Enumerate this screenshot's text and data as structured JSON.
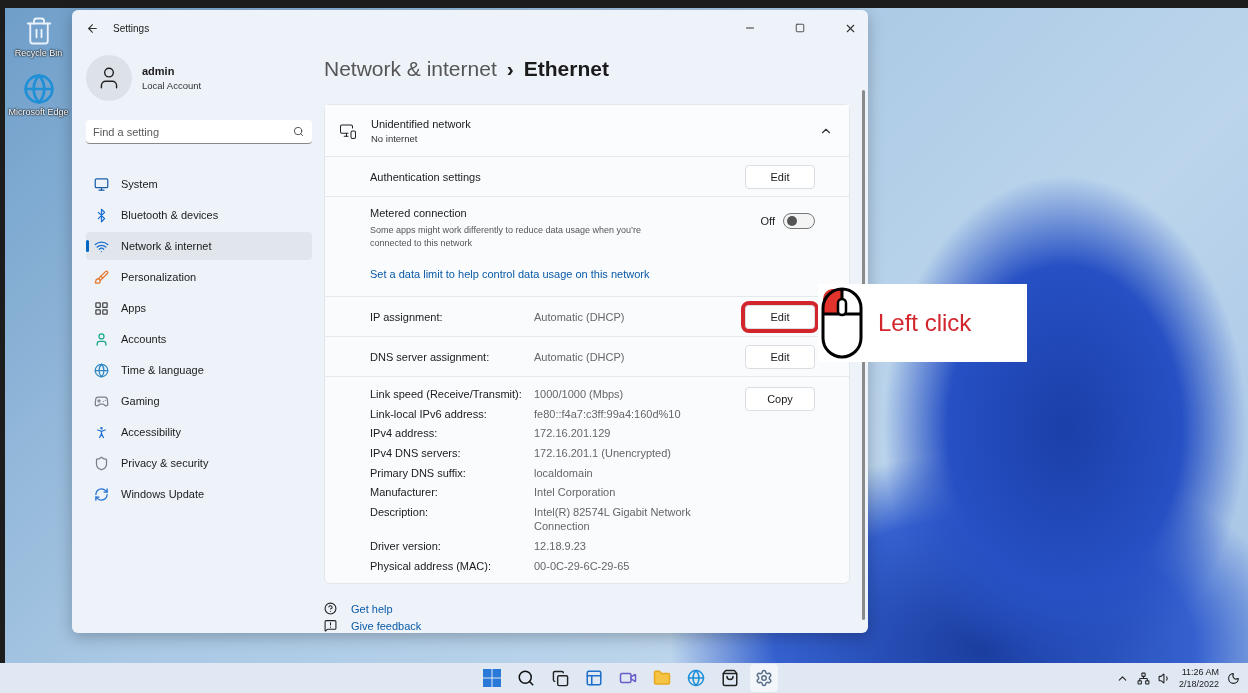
{
  "desktop_icons": [
    {
      "label": "Recycle Bin",
      "kind": "bin"
    },
    {
      "label": "Microsoft Edge",
      "kind": "edge"
    }
  ],
  "window": {
    "title": "Settings"
  },
  "profile": {
    "name": "admin",
    "account_type": "Local Account"
  },
  "search": {
    "placeholder": "Find a setting"
  },
  "sidebar": {
    "items": [
      {
        "label": "System",
        "selected": false
      },
      {
        "label": "Bluetooth & devices",
        "selected": false
      },
      {
        "label": "Network & internet",
        "selected": true
      },
      {
        "label": "Personalization",
        "selected": false
      },
      {
        "label": "Apps",
        "selected": false
      },
      {
        "label": "Accounts",
        "selected": false
      },
      {
        "label": "Time & language",
        "selected": false
      },
      {
        "label": "Gaming",
        "selected": false
      },
      {
        "label": "Accessibility",
        "selected": false
      },
      {
        "label": "Privacy & security",
        "selected": false
      },
      {
        "label": "Windows Update",
        "selected": false
      }
    ]
  },
  "breadcrumb": {
    "parent": "Network & internet",
    "separator": "›",
    "current": "Ethernet"
  },
  "network": {
    "name": "Unidentified network",
    "status": "No internet",
    "expanded": true
  },
  "rows": [
    {
      "kind": "button",
      "label": "Authentication settings",
      "button": "Edit",
      "highlighted": false
    },
    {
      "kind": "toggle",
      "label": "Metered connection",
      "description": "Some apps might work differently to reduce data usage when you’re connected to this network",
      "toggle_label": "Off",
      "on": false,
      "link": "Set a data limit to help control data usage on this network"
    },
    {
      "kind": "button",
      "label": "IP assignment:",
      "value": "Automatic (DHCP)",
      "button": "Edit",
      "highlighted": true
    },
    {
      "kind": "button",
      "label": "DNS server assignment:",
      "value": "Automatic (DHCP)",
      "button": "Edit",
      "highlighted": false
    },
    {
      "kind": "details",
      "button": "Copy",
      "properties": [
        {
          "label": "Link speed (Receive/Transmit):",
          "value": "1000/1000 (Mbps)"
        },
        {
          "label": "Link-local IPv6 address:",
          "value": "fe80::f4a7:c3ff:99a4:160d%10"
        },
        {
          "label": "IPv4 address:",
          "value": "172.16.201.129"
        },
        {
          "label": "IPv4 DNS servers:",
          "value": "172.16.201.1 (Unencrypted)"
        },
        {
          "label": "Primary DNS suffix:",
          "value": "localdomain"
        },
        {
          "label": "Manufacturer:",
          "value": "Intel Corporation"
        },
        {
          "label": "Description:",
          "value": "Intel(R) 82574L Gigabit Network Connection"
        },
        {
          "label": "Driver version:",
          "value": "12.18.9.23"
        },
        {
          "label": "Physical address (MAC):",
          "value": "00-0C-29-6C-29-65"
        }
      ]
    }
  ],
  "links": [
    {
      "label": "Get help",
      "kind": "help"
    },
    {
      "label": "Give feedback",
      "kind": "feedback"
    }
  ],
  "callout": {
    "text": "Left click"
  },
  "tray": {
    "time": "11:26 AM",
    "date": "2/18/2022"
  }
}
